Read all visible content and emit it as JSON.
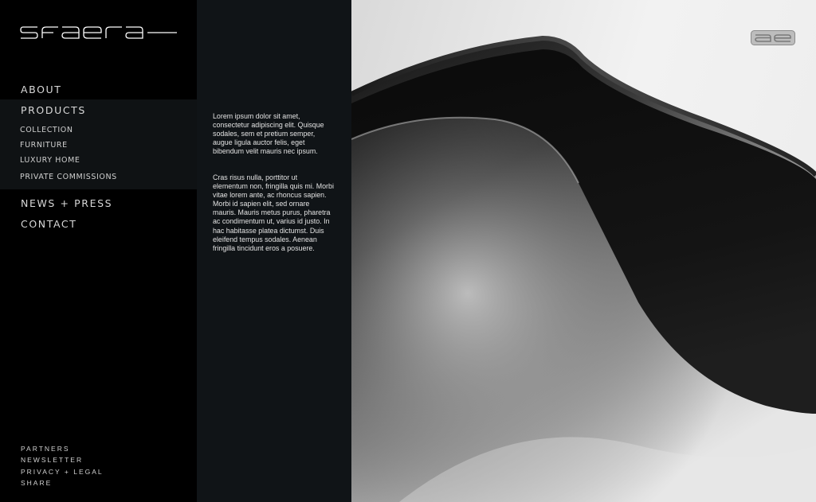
{
  "brand": {
    "logo_text": "sfaera",
    "badge_text": "ae"
  },
  "nav": {
    "about": "ABOUT",
    "products": "PRODUCTS",
    "products_sub": [
      "COLLECTION",
      "FURNITURE",
      "LUXURY HOME",
      "PRIVATE COMMISSIONS"
    ],
    "news": "NEWS + PRESS",
    "contact": "CONTACT"
  },
  "footer": [
    "PARTNERS",
    "NEWSLETTER",
    "PRIVACY + LEGAL",
    "SHARE"
  ],
  "content": {
    "paragraph_1": "Lorem ipsum dolor sit amet, consectetur adipiscing elit. Quisque sodales, sem et pretium semper, augue ligula auctor felis, eget bibendum velit mauris nec ipsum.",
    "paragraph_2": "Cras risus nulla, porttitor ut elementum non, fringilla quis mi. Morbi vitae lorem ante, ac rhoncus sapien. Morbi id sapien elit, sed ornare mauris. Mauris metus purus, pharetra ac condimentum ut, varius id justo. In hac habitasse platea dictumst. Duis eleifend tempus sodales. Aenean fringilla tincidunt eros a posuere."
  },
  "colors": {
    "sidebar_bg": "#000000",
    "products_band_bg": "#0f1214",
    "text_column_bg": "#101417",
    "nav_text": "#d8d8d8"
  }
}
